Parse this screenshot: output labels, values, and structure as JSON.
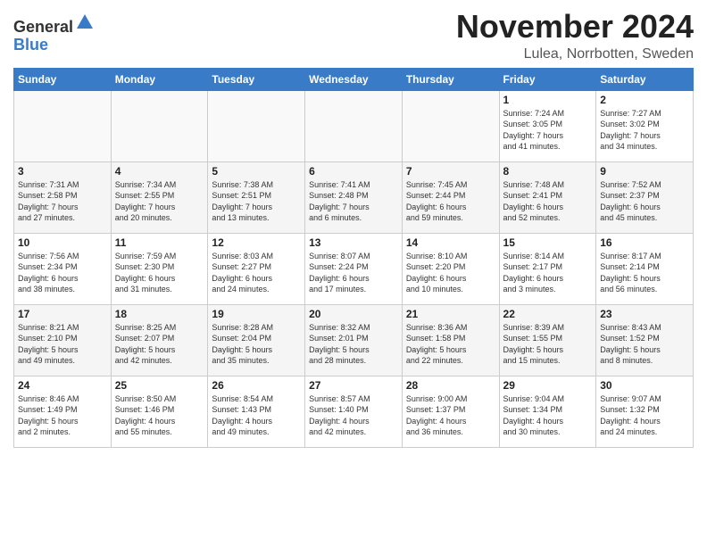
{
  "header": {
    "logo_general": "General",
    "logo_blue": "Blue",
    "month_title": "November 2024",
    "location": "Lulea, Norrbotten, Sweden"
  },
  "weekdays": [
    "Sunday",
    "Monday",
    "Tuesday",
    "Wednesday",
    "Thursday",
    "Friday",
    "Saturday"
  ],
  "weeks": [
    [
      {
        "day": "",
        "info": ""
      },
      {
        "day": "",
        "info": ""
      },
      {
        "day": "",
        "info": ""
      },
      {
        "day": "",
        "info": ""
      },
      {
        "day": "",
        "info": ""
      },
      {
        "day": "1",
        "info": "Sunrise: 7:24 AM\nSunset: 3:05 PM\nDaylight: 7 hours\nand 41 minutes."
      },
      {
        "day": "2",
        "info": "Sunrise: 7:27 AM\nSunset: 3:02 PM\nDaylight: 7 hours\nand 34 minutes."
      }
    ],
    [
      {
        "day": "3",
        "info": "Sunrise: 7:31 AM\nSunset: 2:58 PM\nDaylight: 7 hours\nand 27 minutes."
      },
      {
        "day": "4",
        "info": "Sunrise: 7:34 AM\nSunset: 2:55 PM\nDaylight: 7 hours\nand 20 minutes."
      },
      {
        "day": "5",
        "info": "Sunrise: 7:38 AM\nSunset: 2:51 PM\nDaylight: 7 hours\nand 13 minutes."
      },
      {
        "day": "6",
        "info": "Sunrise: 7:41 AM\nSunset: 2:48 PM\nDaylight: 7 hours\nand 6 minutes."
      },
      {
        "day": "7",
        "info": "Sunrise: 7:45 AM\nSunset: 2:44 PM\nDaylight: 6 hours\nand 59 minutes."
      },
      {
        "day": "8",
        "info": "Sunrise: 7:48 AM\nSunset: 2:41 PM\nDaylight: 6 hours\nand 52 minutes."
      },
      {
        "day": "9",
        "info": "Sunrise: 7:52 AM\nSunset: 2:37 PM\nDaylight: 6 hours\nand 45 minutes."
      }
    ],
    [
      {
        "day": "10",
        "info": "Sunrise: 7:56 AM\nSunset: 2:34 PM\nDaylight: 6 hours\nand 38 minutes."
      },
      {
        "day": "11",
        "info": "Sunrise: 7:59 AM\nSunset: 2:30 PM\nDaylight: 6 hours\nand 31 minutes."
      },
      {
        "day": "12",
        "info": "Sunrise: 8:03 AM\nSunset: 2:27 PM\nDaylight: 6 hours\nand 24 minutes."
      },
      {
        "day": "13",
        "info": "Sunrise: 8:07 AM\nSunset: 2:24 PM\nDaylight: 6 hours\nand 17 minutes."
      },
      {
        "day": "14",
        "info": "Sunrise: 8:10 AM\nSunset: 2:20 PM\nDaylight: 6 hours\nand 10 minutes."
      },
      {
        "day": "15",
        "info": "Sunrise: 8:14 AM\nSunset: 2:17 PM\nDaylight: 6 hours\nand 3 minutes."
      },
      {
        "day": "16",
        "info": "Sunrise: 8:17 AM\nSunset: 2:14 PM\nDaylight: 5 hours\nand 56 minutes."
      }
    ],
    [
      {
        "day": "17",
        "info": "Sunrise: 8:21 AM\nSunset: 2:10 PM\nDaylight: 5 hours\nand 49 minutes."
      },
      {
        "day": "18",
        "info": "Sunrise: 8:25 AM\nSunset: 2:07 PM\nDaylight: 5 hours\nand 42 minutes."
      },
      {
        "day": "19",
        "info": "Sunrise: 8:28 AM\nSunset: 2:04 PM\nDaylight: 5 hours\nand 35 minutes."
      },
      {
        "day": "20",
        "info": "Sunrise: 8:32 AM\nSunset: 2:01 PM\nDaylight: 5 hours\nand 28 minutes."
      },
      {
        "day": "21",
        "info": "Sunrise: 8:36 AM\nSunset: 1:58 PM\nDaylight: 5 hours\nand 22 minutes."
      },
      {
        "day": "22",
        "info": "Sunrise: 8:39 AM\nSunset: 1:55 PM\nDaylight: 5 hours\nand 15 minutes."
      },
      {
        "day": "23",
        "info": "Sunrise: 8:43 AM\nSunset: 1:52 PM\nDaylight: 5 hours\nand 8 minutes."
      }
    ],
    [
      {
        "day": "24",
        "info": "Sunrise: 8:46 AM\nSunset: 1:49 PM\nDaylight: 5 hours\nand 2 minutes."
      },
      {
        "day": "25",
        "info": "Sunrise: 8:50 AM\nSunset: 1:46 PM\nDaylight: 4 hours\nand 55 minutes."
      },
      {
        "day": "26",
        "info": "Sunrise: 8:54 AM\nSunset: 1:43 PM\nDaylight: 4 hours\nand 49 minutes."
      },
      {
        "day": "27",
        "info": "Sunrise: 8:57 AM\nSunset: 1:40 PM\nDaylight: 4 hours\nand 42 minutes."
      },
      {
        "day": "28",
        "info": "Sunrise: 9:00 AM\nSunset: 1:37 PM\nDaylight: 4 hours\nand 36 minutes."
      },
      {
        "day": "29",
        "info": "Sunrise: 9:04 AM\nSunset: 1:34 PM\nDaylight: 4 hours\nand 30 minutes."
      },
      {
        "day": "30",
        "info": "Sunrise: 9:07 AM\nSunset: 1:32 PM\nDaylight: 4 hours\nand 24 minutes."
      }
    ]
  ]
}
